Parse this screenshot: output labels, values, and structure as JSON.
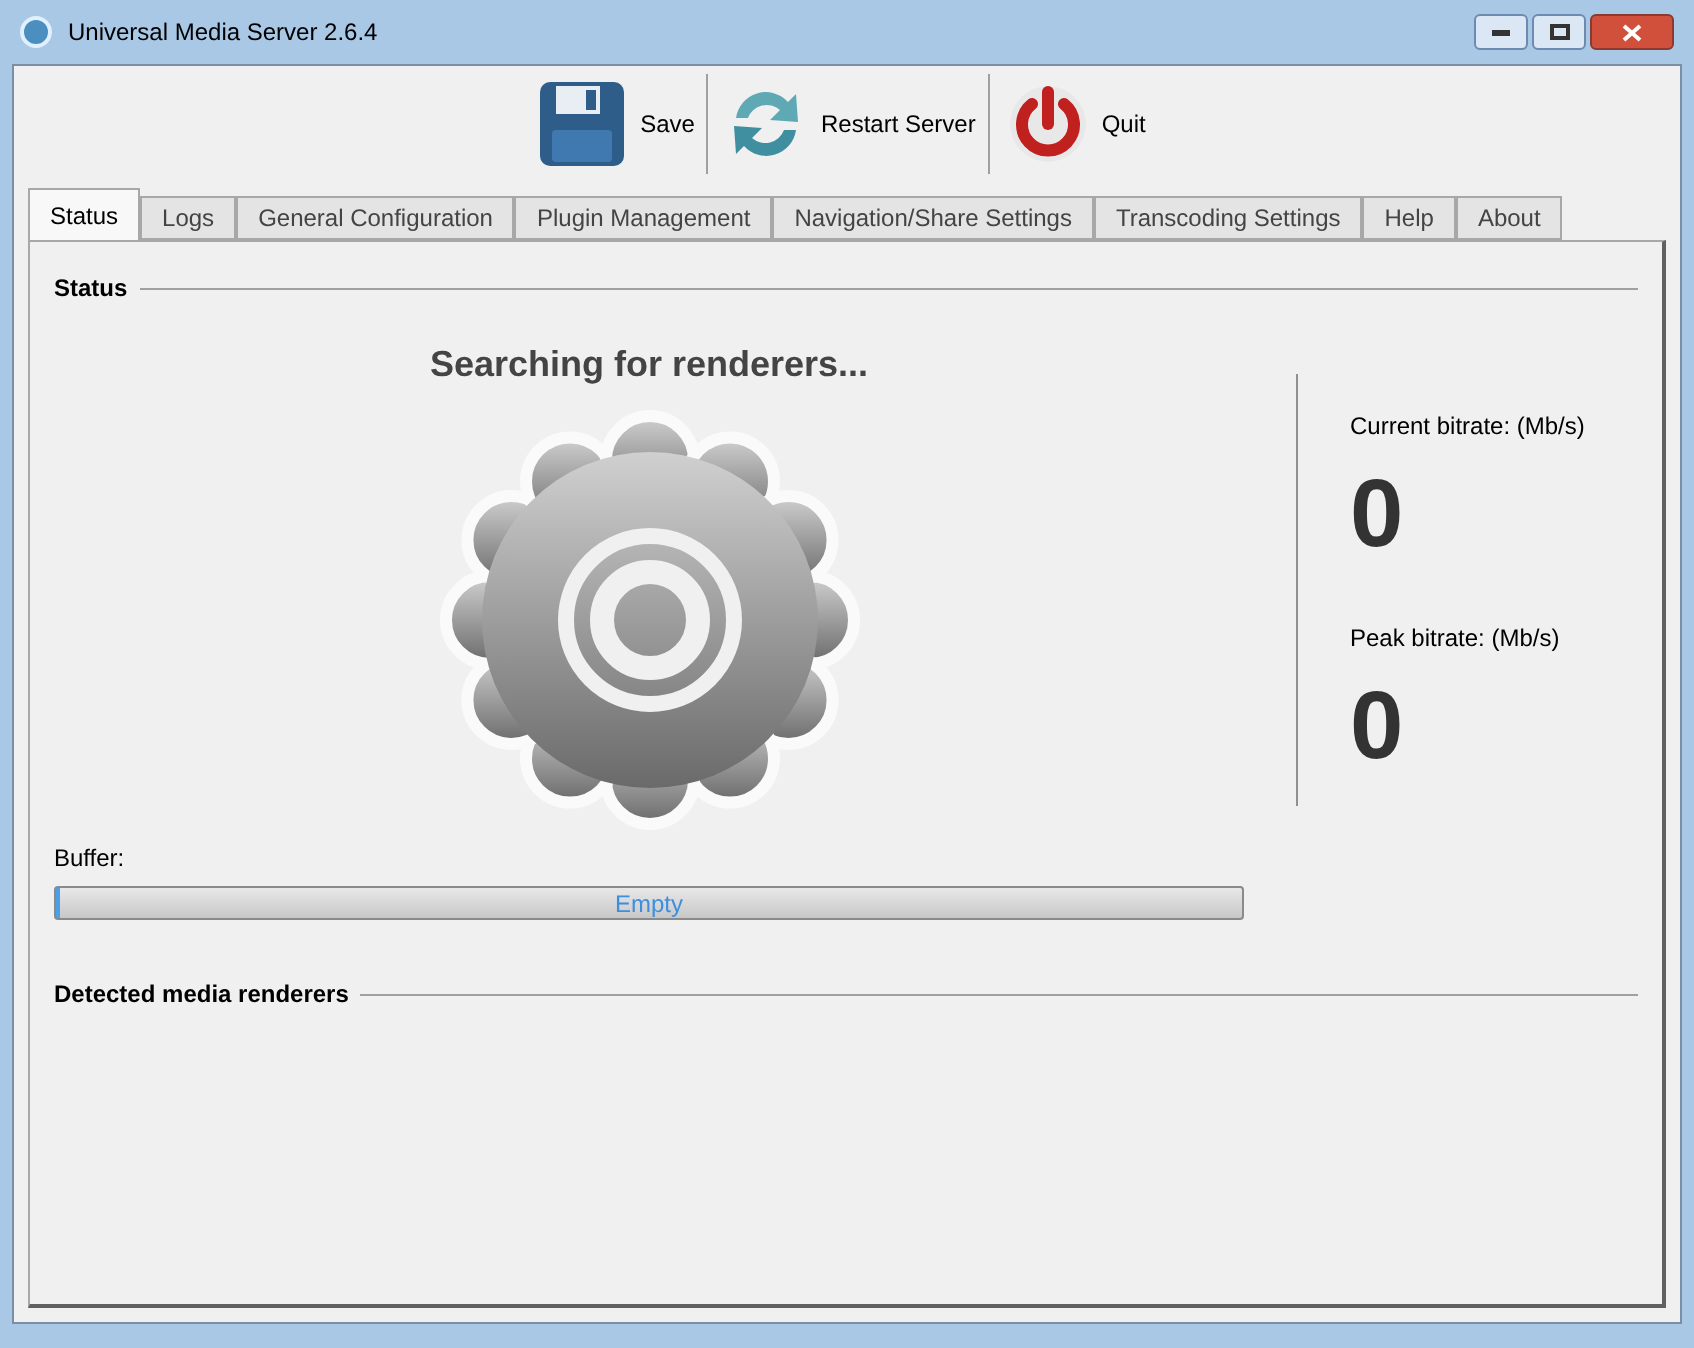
{
  "window": {
    "title": "Universal Media Server 2.6.4"
  },
  "toolbar": [
    {
      "kind": "save",
      "label": "Save"
    },
    {
      "kind": "restart",
      "label": "Restart Server"
    },
    {
      "kind": "quit",
      "label": "Quit"
    }
  ],
  "tabs": [
    {
      "label": "Status",
      "selected": true
    },
    {
      "label": "Logs",
      "selected": false
    },
    {
      "label": "General Configuration",
      "selected": false
    },
    {
      "label": "Plugin Management",
      "selected": false
    },
    {
      "label": "Navigation/Share Settings",
      "selected": false
    },
    {
      "label": "Transcoding Settings",
      "selected": false
    },
    {
      "label": "Help",
      "selected": false
    },
    {
      "label": "About",
      "selected": false
    }
  ],
  "status": {
    "heading": "Status",
    "message": "Searching for renderers...",
    "current_bitrate_label": "Current bitrate: (Mb/s)",
    "current_bitrate": "0",
    "peak_bitrate_label": "Peak bitrate: (Mb/s)",
    "peak_bitrate": "0",
    "buffer_label": "Buffer:",
    "buffer": {
      "level": 0,
      "text": "Empty"
    }
  },
  "renderers": {
    "heading": "Detected media renderers"
  }
}
